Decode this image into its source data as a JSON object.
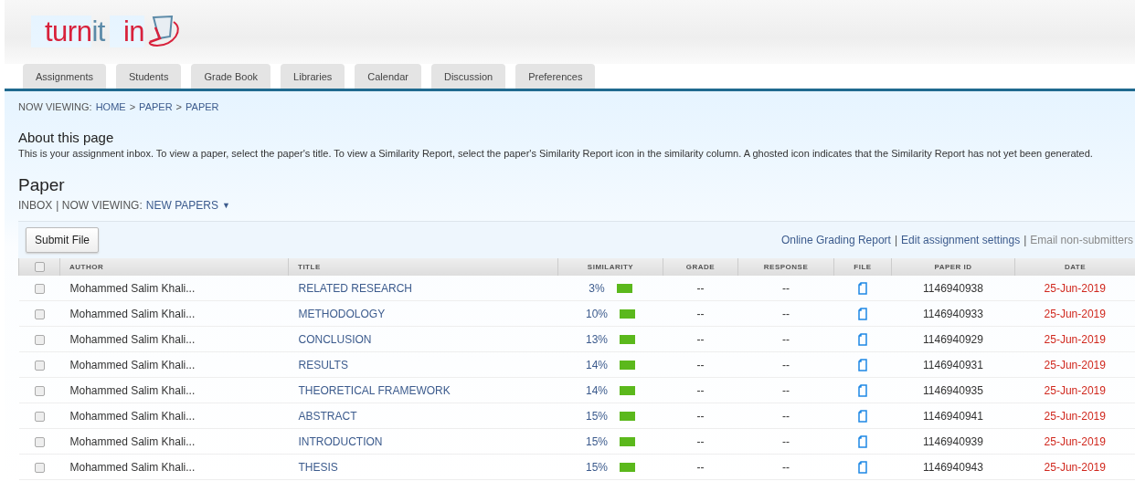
{
  "logo": {
    "parts": [
      {
        "text": "turn",
        "kind": "main"
      },
      {
        "text": "it",
        "kind": "accent"
      },
      {
        "text": "in",
        "kind": "main"
      }
    ]
  },
  "tabs": [
    {
      "label": "Assignments",
      "selected": false
    },
    {
      "label": "Students",
      "selected": false
    },
    {
      "label": "Grade Book",
      "selected": false
    },
    {
      "label": "Libraries",
      "selected": false
    },
    {
      "label": "Calendar",
      "selected": false
    },
    {
      "label": "Discussion",
      "selected": false
    },
    {
      "label": "Preferences",
      "selected": false
    }
  ],
  "breadcrumb": {
    "prefix": "NOW VIEWING:",
    "items": [
      "HOME",
      "PAPER",
      "PAPER"
    ],
    "separator": ">"
  },
  "about": {
    "title": "About this page",
    "text": "This is your assignment inbox. To view a paper, select the paper's title. To view a Similarity Report, select the paper's Similarity Report icon in the similarity column. A ghosted icon indicates that the Similarity Report has not yet been generated."
  },
  "paper": {
    "title": "Paper",
    "inbox": "INBOX",
    "viewing_label": "| NOW VIEWING:",
    "viewing_value": "NEW PAPERS",
    "caret": "▼"
  },
  "toolbar": {
    "button": "Submit File",
    "links": [
      {
        "label": "Online Grading Report",
        "disabled": false
      },
      {
        "label": "Edit assignment settings",
        "disabled": false
      },
      {
        "label": "Email non-submitters",
        "disabled": true
      }
    ],
    "separator": "|"
  },
  "table": {
    "select_all_checked": false,
    "columns": [
      "AUTHOR",
      "TITLE",
      "SIMILARITY",
      "GRADE",
      "RESPONSE",
      "FILE",
      "PAPER ID",
      "DATE"
    ],
    "rows": [
      {
        "checked": false,
        "author": "Mohammed Salim Khali...",
        "title": "RELATED RESEARCH",
        "similarity": "3%",
        "grade": "--",
        "response": "--",
        "paper_id": "1146940938",
        "date": "25-Jun-2019"
      },
      {
        "checked": false,
        "author": "Mohammed Salim Khali...",
        "title": "METHODOLOGY",
        "similarity": "10%",
        "grade": "--",
        "response": "--",
        "paper_id": "1146940933",
        "date": "25-Jun-2019"
      },
      {
        "checked": false,
        "author": "Mohammed Salim Khali...",
        "title": "CONCLUSION",
        "similarity": "13%",
        "grade": "--",
        "response": "--",
        "paper_id": "1146940929",
        "date": "25-Jun-2019"
      },
      {
        "checked": false,
        "author": "Mohammed Salim Khali...",
        "title": "RESULTS",
        "similarity": "14%",
        "grade": "--",
        "response": "--",
        "paper_id": "1146940931",
        "date": "25-Jun-2019"
      },
      {
        "checked": false,
        "author": "Mohammed Salim Khali...",
        "title": "THEORETICAL FRAMEWORK",
        "similarity": "14%",
        "grade": "--",
        "response": "--",
        "paper_id": "1146940935",
        "date": "25-Jun-2019"
      },
      {
        "checked": false,
        "author": "Mohammed Salim Khali...",
        "title": "ABSTRACT",
        "similarity": "15%",
        "grade": "--",
        "response": "--",
        "paper_id": "1146940941",
        "date": "25-Jun-2019"
      },
      {
        "checked": false,
        "author": "Mohammed Salim Khali...",
        "title": "INTRODUCTION",
        "similarity": "15%",
        "grade": "--",
        "response": "--",
        "paper_id": "1146940939",
        "date": "25-Jun-2019"
      },
      {
        "checked": false,
        "author": "Mohammed Salim Khali...",
        "title": "THESIS",
        "similarity": "15%",
        "grade": "--",
        "response": "--",
        "paper_id": "1146940943",
        "date": "25-Jun-2019"
      }
    ]
  }
}
